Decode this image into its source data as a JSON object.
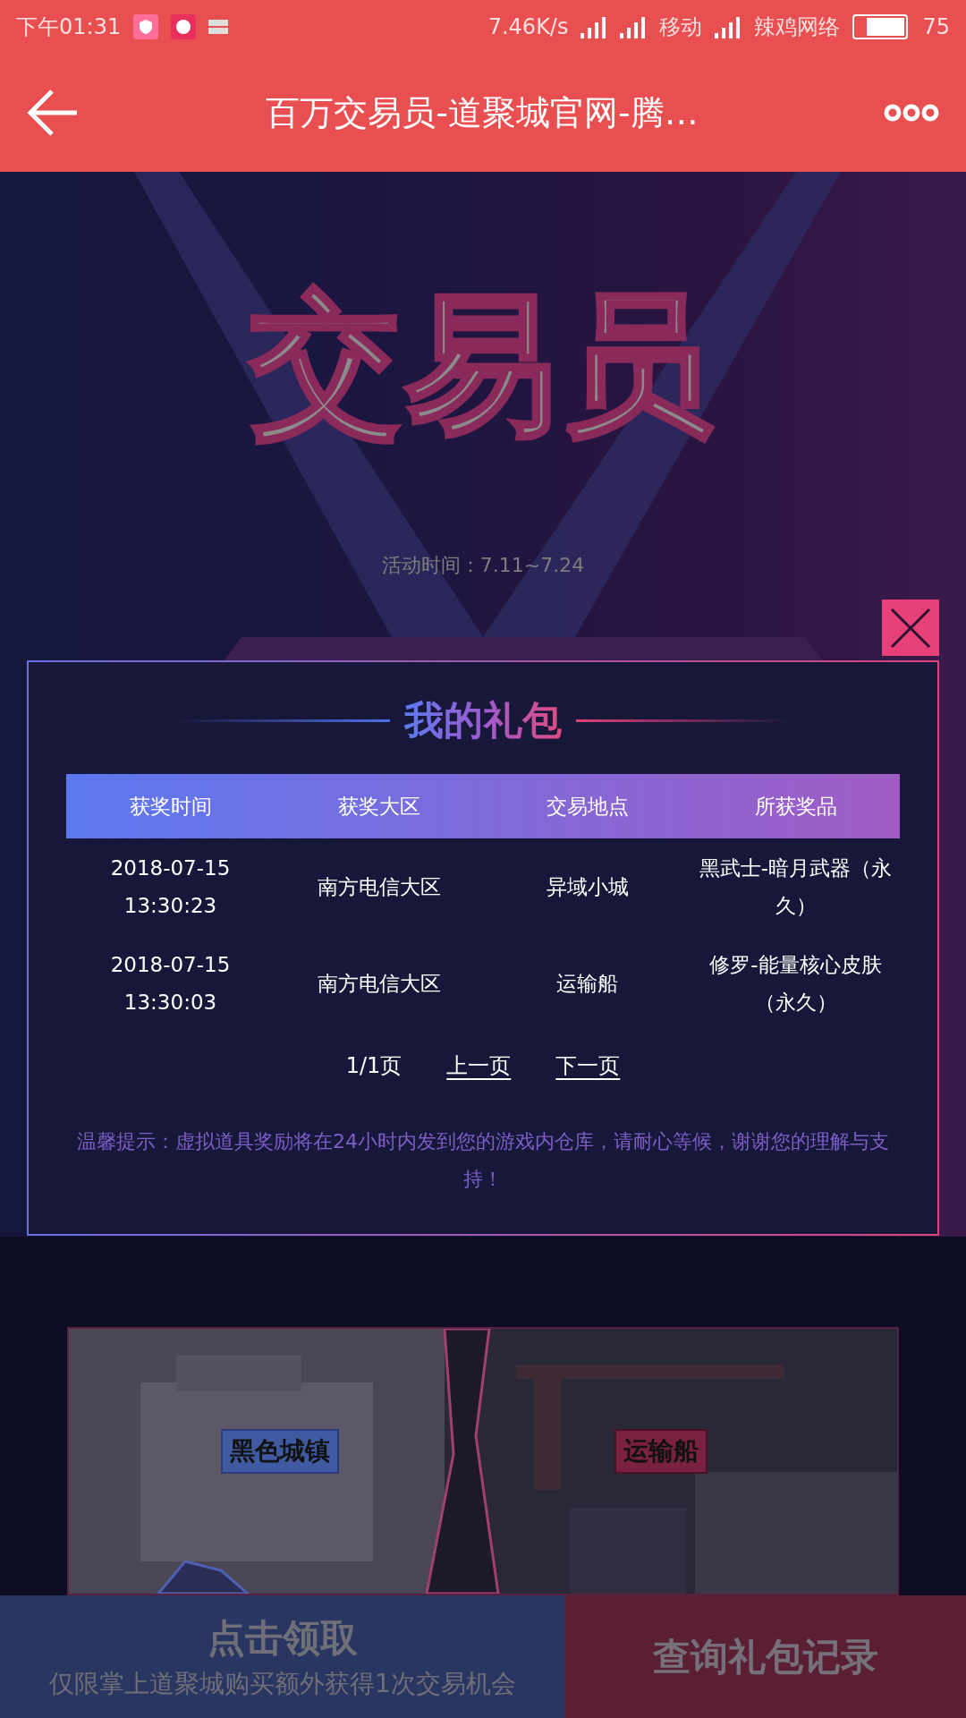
{
  "status_bar": {
    "time": "下午01:31",
    "speed": "7.46K/s",
    "carrier": "移动",
    "network": "辣鸡网络",
    "battery": "75"
  },
  "header": {
    "title": "百万交易员-道聚城官网-腾…"
  },
  "banner": {
    "title": "交易员",
    "period": "活动时间：7.11~7.24"
  },
  "dialog": {
    "title": "我的礼包",
    "columns": [
      "获奖时间",
      "获奖大区",
      "交易地点",
      "所获奖品"
    ],
    "rows": [
      {
        "time": "2018-07-15 13:30:23",
        "region": "南方电信大区",
        "place": "异域小城",
        "prize": "黑武士-暗月武器（永久）"
      },
      {
        "time": "2018-07-15 13:30:03",
        "region": "南方电信大区",
        "place": "运输船",
        "prize": "修罗-能量核心皮肤（永久）"
      }
    ],
    "pager": {
      "page": "1/1页",
      "prev": "上一页",
      "next": "下一页"
    },
    "notice": "温馨提示：虚拟道具奖励将在24小时内发到您的游戏内仓库，请耐心等候，谢谢您的理解与支持！"
  },
  "map": {
    "labels": [
      {
        "text": "黑色城镇",
        "kind": "blue"
      },
      {
        "text": "运输船",
        "kind": "red"
      }
    ]
  },
  "bottom": {
    "claim": {
      "title": "点击领取",
      "subtitle": "仅限掌上道聚城购买额外获得1次交易机会"
    },
    "records": "查询礼包记录"
  }
}
